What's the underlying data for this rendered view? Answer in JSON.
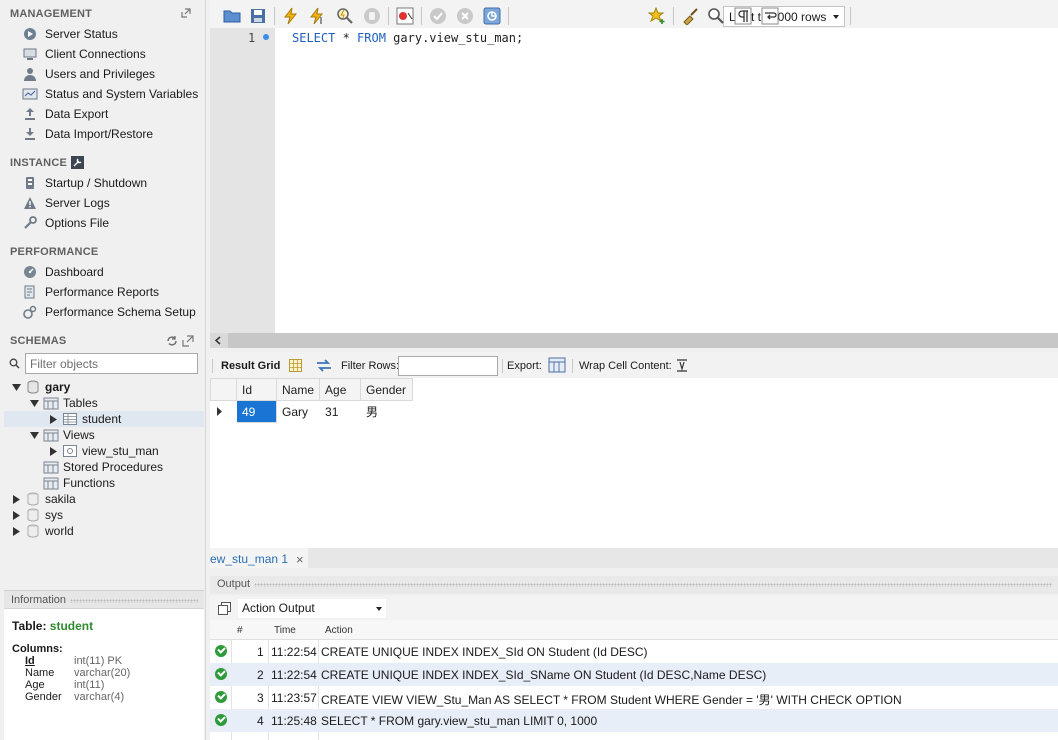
{
  "sidebar": {
    "management": {
      "title": "MANAGEMENT",
      "items": [
        {
          "label": "Server Status",
          "icon": "server-status-icon"
        },
        {
          "label": "Client Connections",
          "icon": "client-connections-icon"
        },
        {
          "label": "Users and Privileges",
          "icon": "user-icon"
        },
        {
          "label": "Status and System Variables",
          "icon": "variables-icon"
        },
        {
          "label": "Data Export",
          "icon": "export-icon"
        },
        {
          "label": "Data Import/Restore",
          "icon": "import-icon"
        }
      ]
    },
    "instance": {
      "title": "INSTANCE",
      "items": [
        {
          "label": "Startup / Shutdown",
          "icon": "startup-icon"
        },
        {
          "label": "Server Logs",
          "icon": "warning-icon"
        },
        {
          "label": "Options File",
          "icon": "wrench-icon"
        }
      ]
    },
    "performance": {
      "title": "PERFORMANCE",
      "items": [
        {
          "label": "Dashboard",
          "icon": "dashboard-icon"
        },
        {
          "label": "Performance Reports",
          "icon": "reports-icon"
        },
        {
          "label": "Performance Schema Setup",
          "icon": "schema-setup-icon"
        }
      ]
    },
    "schemas": {
      "title": "SCHEMAS",
      "filter_placeholder": "Filter objects",
      "tree": {
        "db": "gary",
        "tables": "Tables",
        "table_student": "student",
        "views": "Views",
        "view_item": "view_stu_man",
        "procedures": "Stored Procedures",
        "functions": "Functions",
        "other_dbs": [
          "sakila",
          "sys",
          "world"
        ]
      }
    },
    "info": {
      "title": "Information",
      "table_label": "Table:",
      "table_name": "student",
      "columns_label": "Columns:",
      "columns": [
        {
          "name": "Id",
          "type": "int(11) PK"
        },
        {
          "name": "Name",
          "type": "varchar(20)"
        },
        {
          "name": "Age",
          "type": "int(11)"
        },
        {
          "name": "Gender",
          "type": "varchar(4)"
        }
      ]
    }
  },
  "toolbar": {
    "limit": "Limit to 1000 rows"
  },
  "editor": {
    "line_number": "1",
    "kw_select": "SELECT",
    "star": " * ",
    "kw_from": "FROM",
    "rest": " gary.view_stu_man;"
  },
  "result_bar": {
    "result_grid": "Result Grid",
    "filter_rows": "Filter Rows:",
    "export": "Export:",
    "wrap": "Wrap Cell Content:"
  },
  "grid": {
    "headers": [
      "Id",
      "Name",
      "Age",
      "Gender"
    ],
    "rows": [
      [
        "49",
        "Gary",
        "31",
        "男"
      ]
    ]
  },
  "result_tab": {
    "label": "ew_stu_man 1"
  },
  "output": {
    "title": "Output",
    "mode": "Action Output",
    "headers": {
      "num": "#",
      "time": "Time",
      "action": "Action"
    },
    "rows": [
      {
        "num": "1",
        "time": "11:22:54",
        "action": "CREATE UNIQUE INDEX INDEX_SId ON Student (Id DESC)"
      },
      {
        "num": "2",
        "time": "11:22:54",
        "action": "CREATE UNIQUE INDEX INDEX_SId_SName ON Student (Id DESC,Name DESC)"
      },
      {
        "num": "3",
        "time": "11:23:57",
        "action": "CREATE VIEW VIEW_Stu_Man AS SELECT * FROM Student WHERE Gender = '男' WITH CHECK OPTION"
      },
      {
        "num": "4",
        "time": "11:25:48",
        "action": "SELECT * FROM gary.view_stu_man LIMIT 0, 1000"
      }
    ]
  }
}
